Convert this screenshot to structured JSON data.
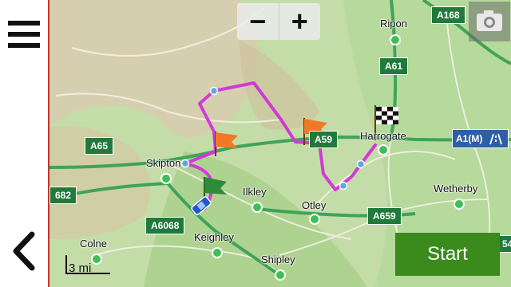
{
  "controls": {
    "zoom_out_label": "−",
    "zoom_in_label": "+",
    "start_label": "Start",
    "scale_label": "3 mi",
    "menu_icon": "hamburger-menu-icon",
    "back_icon": "chevron-left-icon",
    "camera_icon": "camera-icon"
  },
  "places": {
    "ripon": "Ripon",
    "harrogate": "Harrogate",
    "skipton": "Skipton",
    "ilkley": "Ilkley",
    "otley": "Otley",
    "wetherby": "Wetherby",
    "keighley": "Keighley",
    "colne": "Colne",
    "shipley": "Shipley"
  },
  "roads": {
    "a168": "A168",
    "a61": "A61",
    "a65": "A65",
    "a59": "A59",
    "a6068": "A6068",
    "a659": "A659",
    "a682_partial": "682",
    "a1m": "A1(M)",
    "right_edge_partial": "54"
  },
  "colors": {
    "route": "#d13ad6",
    "start_button": "#3a8a1c",
    "road_badge": "#1f7a3b",
    "motorway_badge": "#2d5fa8",
    "waypoint_flag": "#f07a24",
    "origin_flag": "#2e8b3a"
  }
}
